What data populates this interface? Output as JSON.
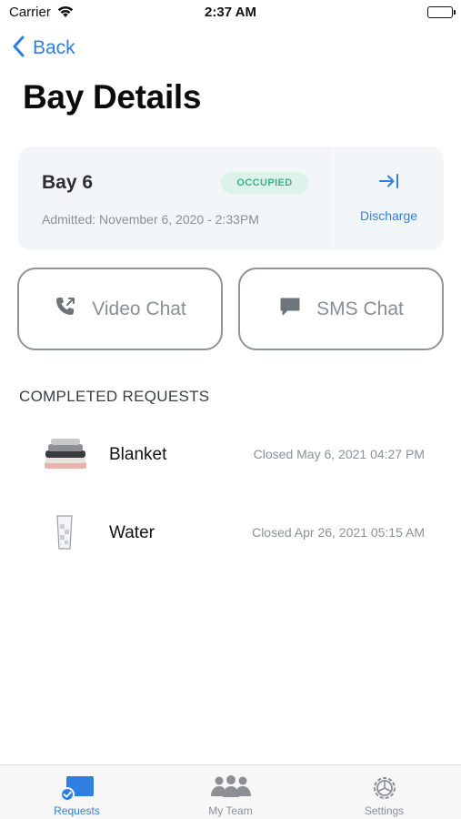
{
  "status_bar": {
    "carrier": "Carrier",
    "time": "2:37 AM"
  },
  "nav": {
    "back_label": "Back"
  },
  "page_title": "Bay Details",
  "bay": {
    "name": "Bay 6",
    "status": "OCCUPIED",
    "admitted": "Admitted: November 6, 2020 - 2:33PM",
    "discharge_label": "Discharge"
  },
  "chat": {
    "video_label": "Video Chat",
    "sms_label": "SMS Chat"
  },
  "completed_requests": {
    "title": "COMPLETED REQUESTS",
    "items": [
      {
        "name": "Blanket",
        "closed": "Closed May 6, 2021 04:27 PM",
        "icon": "blanket-icon"
      },
      {
        "name": "Water",
        "closed": "Closed Apr 26, 2021 05:15 AM",
        "icon": "water-glass-icon"
      }
    ]
  },
  "tab_bar": {
    "tabs": [
      {
        "label": "Requests",
        "icon": "requests-icon",
        "active": true
      },
      {
        "label": "My Team",
        "icon": "team-icon",
        "active": false
      },
      {
        "label": "Settings",
        "icon": "settings-icon",
        "active": false
      }
    ]
  },
  "colors": {
    "accent": "#2f7fe0",
    "occupied_text": "#3fb08c",
    "occupied_bg": "#dcf2ea",
    "card_bg": "#f3f6f8"
  }
}
